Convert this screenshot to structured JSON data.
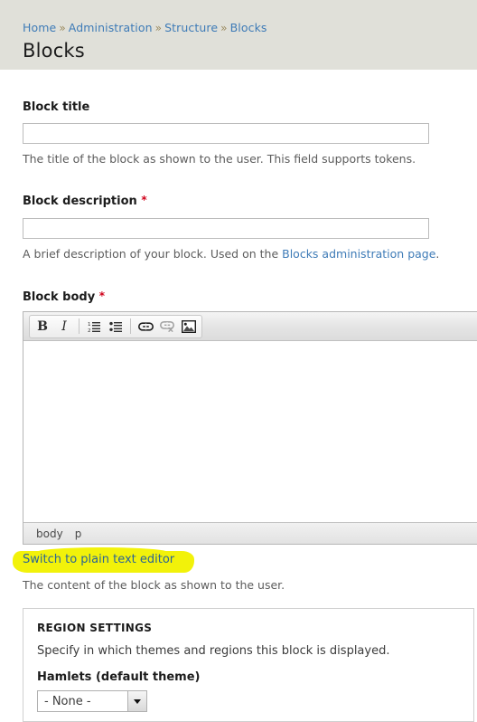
{
  "header": {
    "breadcrumb": [
      {
        "label": "Home"
      },
      {
        "label": "Administration"
      },
      {
        "label": "Structure"
      },
      {
        "label": "Blocks"
      }
    ],
    "separator": "»",
    "title": "Blocks"
  },
  "form": {
    "block_title": {
      "label": "Block title",
      "value": "",
      "placeholder": "",
      "description": "The title of the block as shown to the user. This field supports tokens."
    },
    "block_description": {
      "label": "Block description",
      "required_marker": "*",
      "value": "",
      "placeholder": "",
      "description_before": "A brief description of your block. Used on the ",
      "description_link": "Blocks administration page",
      "description_after": "."
    },
    "block_body": {
      "label": "Block body",
      "required_marker": "*",
      "description": "The content of the block as shown to the user.",
      "switch_link": "Switch to plain text editor",
      "content": ""
    }
  },
  "editor": {
    "toolbar": [
      {
        "name": "bold-icon",
        "label": "B",
        "disabled": false
      },
      {
        "name": "italic-icon",
        "label": "I",
        "disabled": false
      },
      {
        "name": "numbered-list-icon",
        "label": "",
        "disabled": false
      },
      {
        "name": "bulleted-list-icon",
        "label": "",
        "disabled": false
      },
      {
        "name": "link-icon",
        "label": "",
        "disabled": false
      },
      {
        "name": "unlink-icon",
        "label": "",
        "disabled": true
      },
      {
        "name": "image-icon",
        "label": "",
        "disabled": false
      }
    ],
    "status_path": [
      "body",
      "p"
    ]
  },
  "region_settings": {
    "legend": "REGION SETTINGS",
    "description": "Specify in which themes and regions this block is displayed.",
    "theme_label": "Hamlets (default theme)",
    "select_value": "- None -",
    "select_options": [
      "- None -"
    ]
  },
  "colors": {
    "header_bg": "#e0e0d9",
    "link": "#3e7bb7",
    "required": "#d0021b",
    "highlight": "#f2f20a",
    "breadcrumb_separator": "#9b8a5e"
  }
}
